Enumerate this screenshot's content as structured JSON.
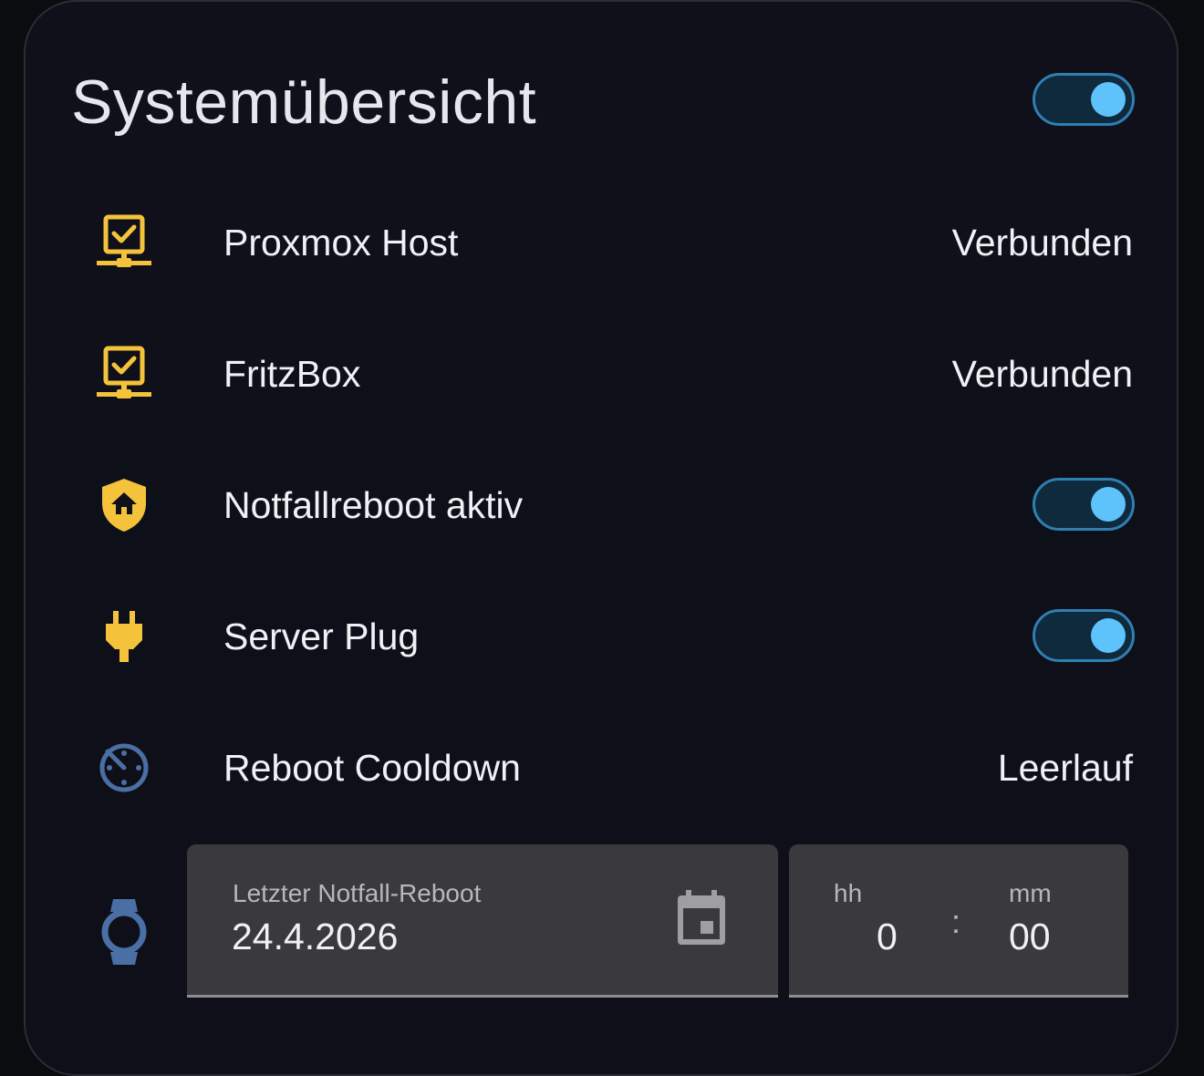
{
  "card": {
    "title": "Systemübersicht",
    "master_toggle_on": true
  },
  "rows": [
    {
      "label": "Proxmox Host",
      "value": "Verbunden",
      "icon": "lan-check-icon",
      "icon_color": "#f5c33b"
    },
    {
      "label": "FritzBox",
      "value": "Verbunden",
      "icon": "lan-check-icon",
      "icon_color": "#f5c33b"
    },
    {
      "label": "Notfallreboot aktiv",
      "toggle_on": true,
      "icon": "shield-home-icon",
      "icon_color": "#f5c33b"
    },
    {
      "label": "Server Plug",
      "toggle_on": true,
      "icon": "power-plug-icon",
      "icon_color": "#f5c33b"
    },
    {
      "label": "Reboot Cooldown",
      "value": "Leerlauf",
      "icon": "timer-off-icon",
      "icon_color": "#4a6fa5"
    }
  ],
  "datetime": {
    "icon": "watch-icon",
    "date_label": "Letzter Notfall-Reboot",
    "date_value": "24.4.2026",
    "hours_label": "hh",
    "hours_value": "0",
    "separator": ":",
    "minutes_label": "mm",
    "minutes_value": "00"
  },
  "colors": {
    "accent_toggle": "#5ec2fb",
    "icon_yellow": "#f5c33b",
    "icon_blue": "#4a6fa5"
  }
}
